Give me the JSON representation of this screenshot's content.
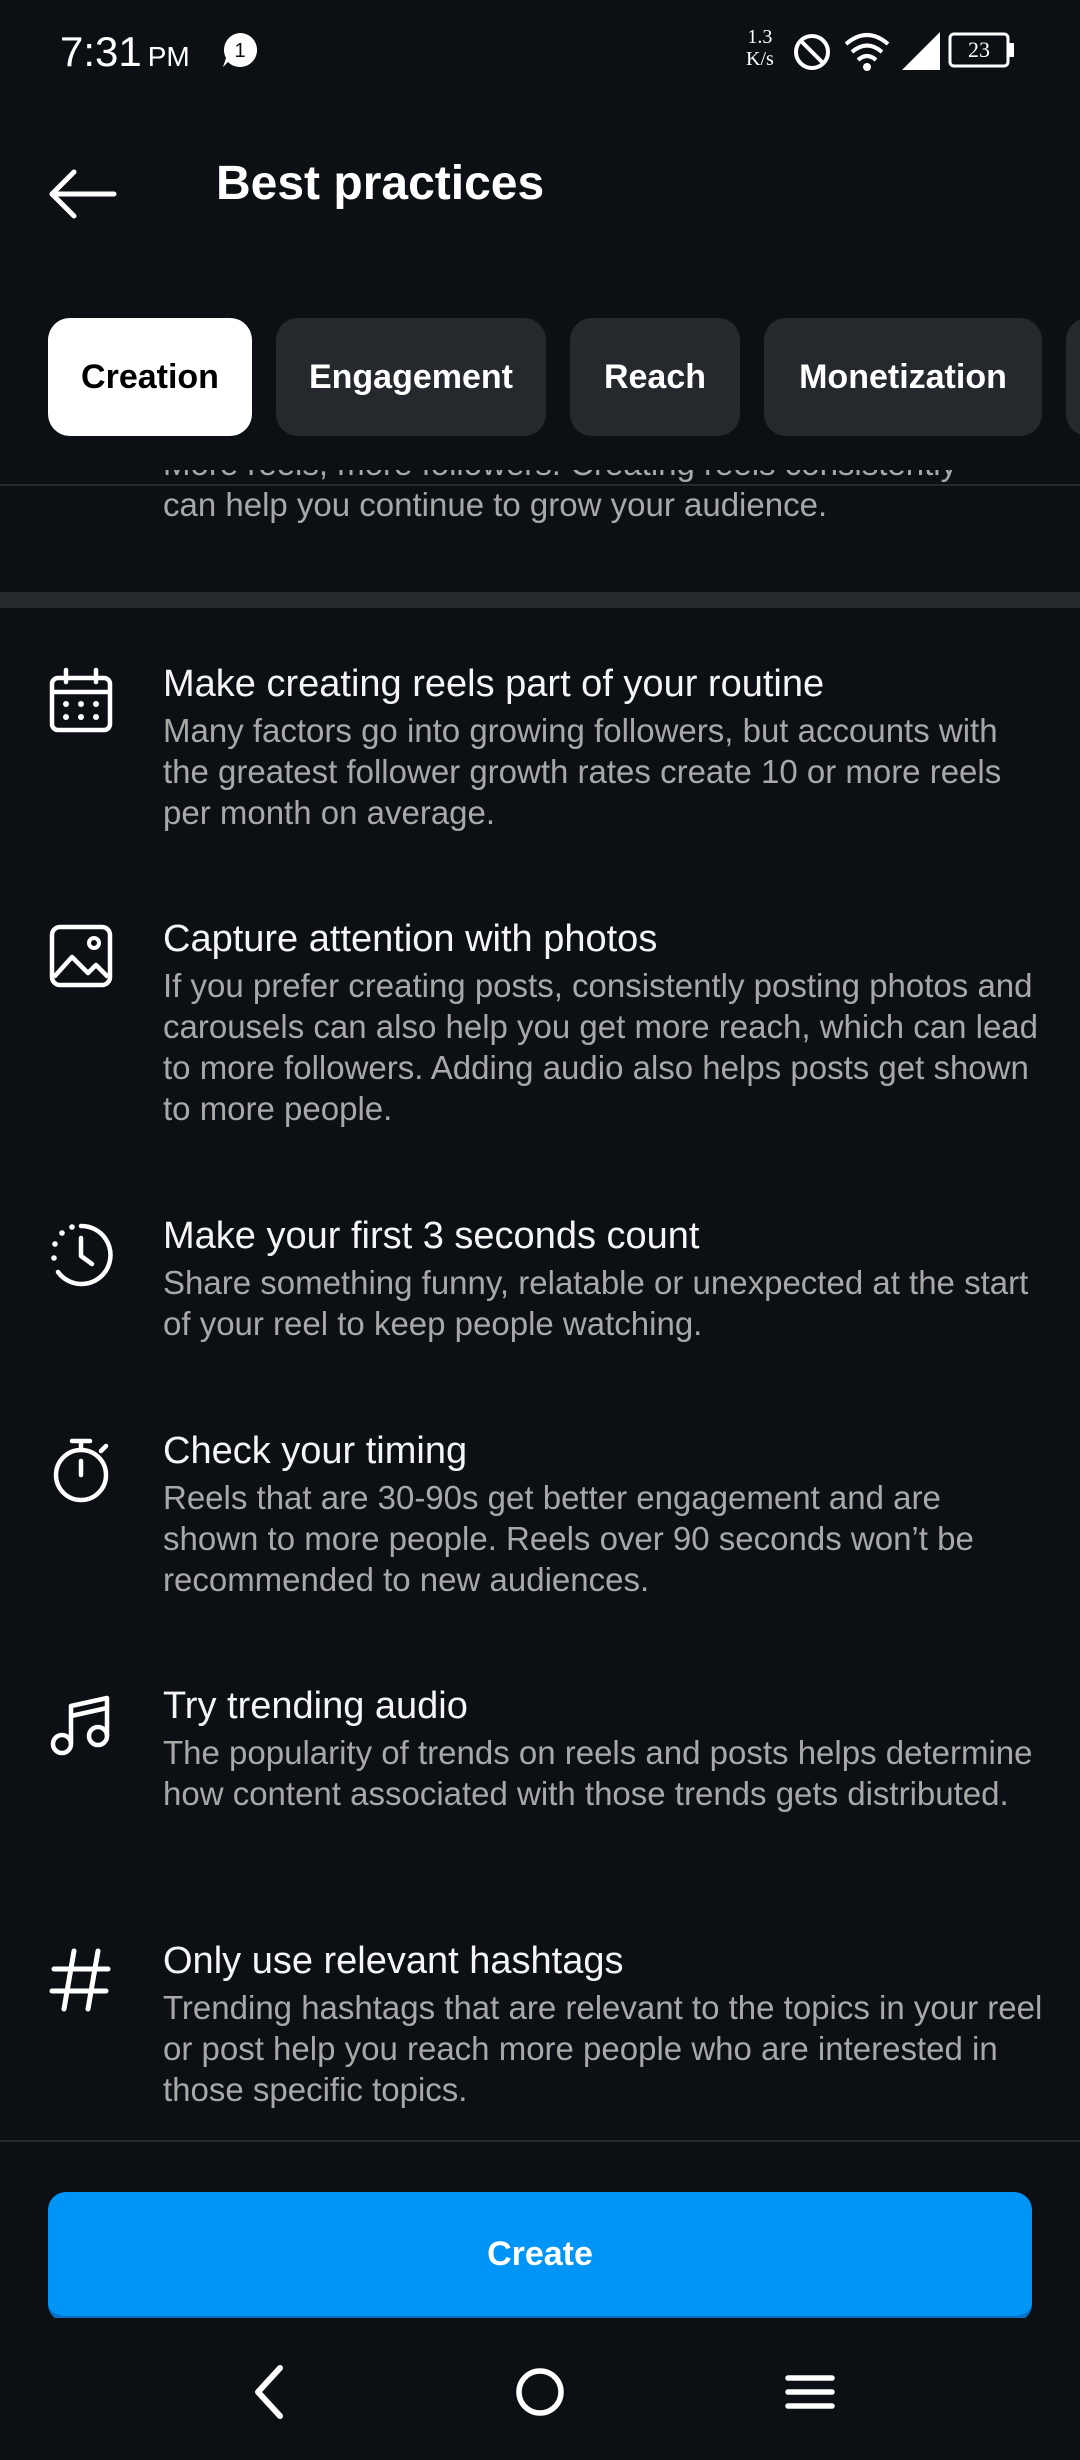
{
  "status_bar": {
    "time": "7:31",
    "ampm": "PM",
    "notification_count": "1",
    "net_speed_top": "1.3",
    "net_speed_bottom": "K/s",
    "battery": "23"
  },
  "header": {
    "title": "Best practices"
  },
  "tabs": [
    {
      "label": "Creation",
      "active": true
    },
    {
      "label": "Engagement",
      "active": false
    },
    {
      "label": "Reach",
      "active": false
    },
    {
      "label": "Monetization",
      "active": false
    }
  ],
  "partial_section": {
    "text_cut": "More reels, more followers. Creating reels consistently",
    "text_visible": "can help you continue to grow your audience."
  },
  "items": [
    {
      "icon": "calendar-icon",
      "title": "Make creating reels part of your routine",
      "description": "Many factors go into growing followers, but accounts with the greatest follower growth rates create 10 or more reels per month on average."
    },
    {
      "icon": "photo-icon",
      "title": "Capture attention with photos",
      "description": "If you prefer creating posts, consistently posting photos and carousels can also help you get more reach, which can lead to more followers. Adding audio also helps posts get shown to more people."
    },
    {
      "icon": "clock-icon",
      "title": "Make your first 3 seconds count",
      "description": "Share something funny, relatable or unexpected at the start of your reel to keep people watching."
    },
    {
      "icon": "stopwatch-icon",
      "title": "Check your timing",
      "description": "Reels that are 30-90s get better engagement and are shown to more people. Reels over 90 seconds won’t be recommended to new audiences."
    },
    {
      "icon": "music-note-icon",
      "title": "Try trending audio",
      "description": "The popularity of trends on reels and posts helps determine how content associated with those trends gets distributed."
    },
    {
      "icon": "hashtag-icon",
      "title": "Only use relevant hashtags",
      "description": "Trending hashtags that are relevant to the topics in your reel or post help you reach more people who are interested in those specific topics."
    }
  ],
  "create_button": {
    "label": "Create"
  },
  "colors": {
    "background": "#0c1014",
    "accent": "#0095f6",
    "tab_inactive": "#25292e",
    "secondary_text": "#a8a8a8"
  }
}
